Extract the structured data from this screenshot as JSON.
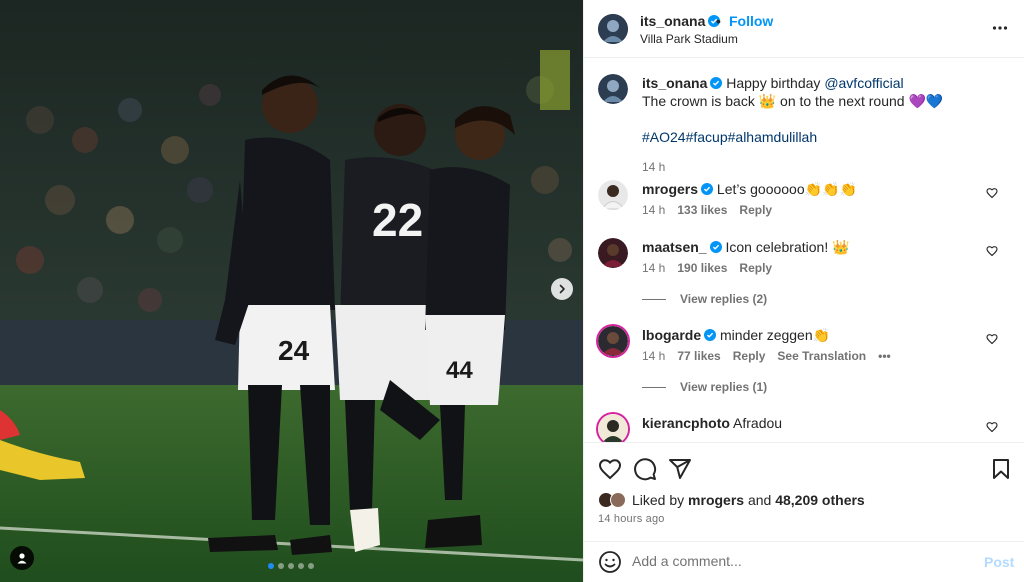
{
  "header": {
    "username": "its_onana",
    "separator": "•",
    "follow_label": "Follow",
    "location": "Villa Park Stadium",
    "more_icon": "more-horizontal-icon"
  },
  "caption": {
    "username": "its_onana",
    "line1_text": "Happy birthday ",
    "mention": "@avfcofficial",
    "line2_text": "The crown is back 👑 on to the next round 💜💙",
    "hashtags": "#AO24#facup#alhamdulillah",
    "time": "14 h"
  },
  "comments": [
    {
      "username": "mrogers",
      "text": "Let’s goooooo👏👏👏",
      "time": "14 h",
      "likes": "133 likes",
      "reply": "Reply"
    },
    {
      "username": "maatsen_",
      "text": "Icon celebration! 👑",
      "time": "14 h",
      "likes": "190 likes",
      "reply": "Reply",
      "view_replies": "View replies (2)"
    },
    {
      "username": "lbogarde",
      "text": "minder zeggen👏",
      "time": "14 h",
      "likes": "77 likes",
      "reply": "Reply",
      "translate": "See Translation",
      "options": "•••",
      "view_replies": "View replies (1)"
    },
    {
      "username": "kierancphoto",
      "text": "Afradou"
    }
  ],
  "media": {
    "jersey_numbers": [
      "24",
      "22",
      "44"
    ],
    "slide_count": 5,
    "active_slide": 1
  },
  "likes": {
    "prefix": "Liked by ",
    "user": "mrogers",
    "middle": " and ",
    "count": "48,209 others"
  },
  "time_ago": "14 HOURS AGO",
  "time_ago_display": "14 hours ago",
  "comment_input": {
    "placeholder": "Add a comment...",
    "post_label": "Post"
  },
  "colors": {
    "accent": "#0095f6",
    "link": "#00376b",
    "muted": "#737373",
    "verified": "#0095f6"
  }
}
